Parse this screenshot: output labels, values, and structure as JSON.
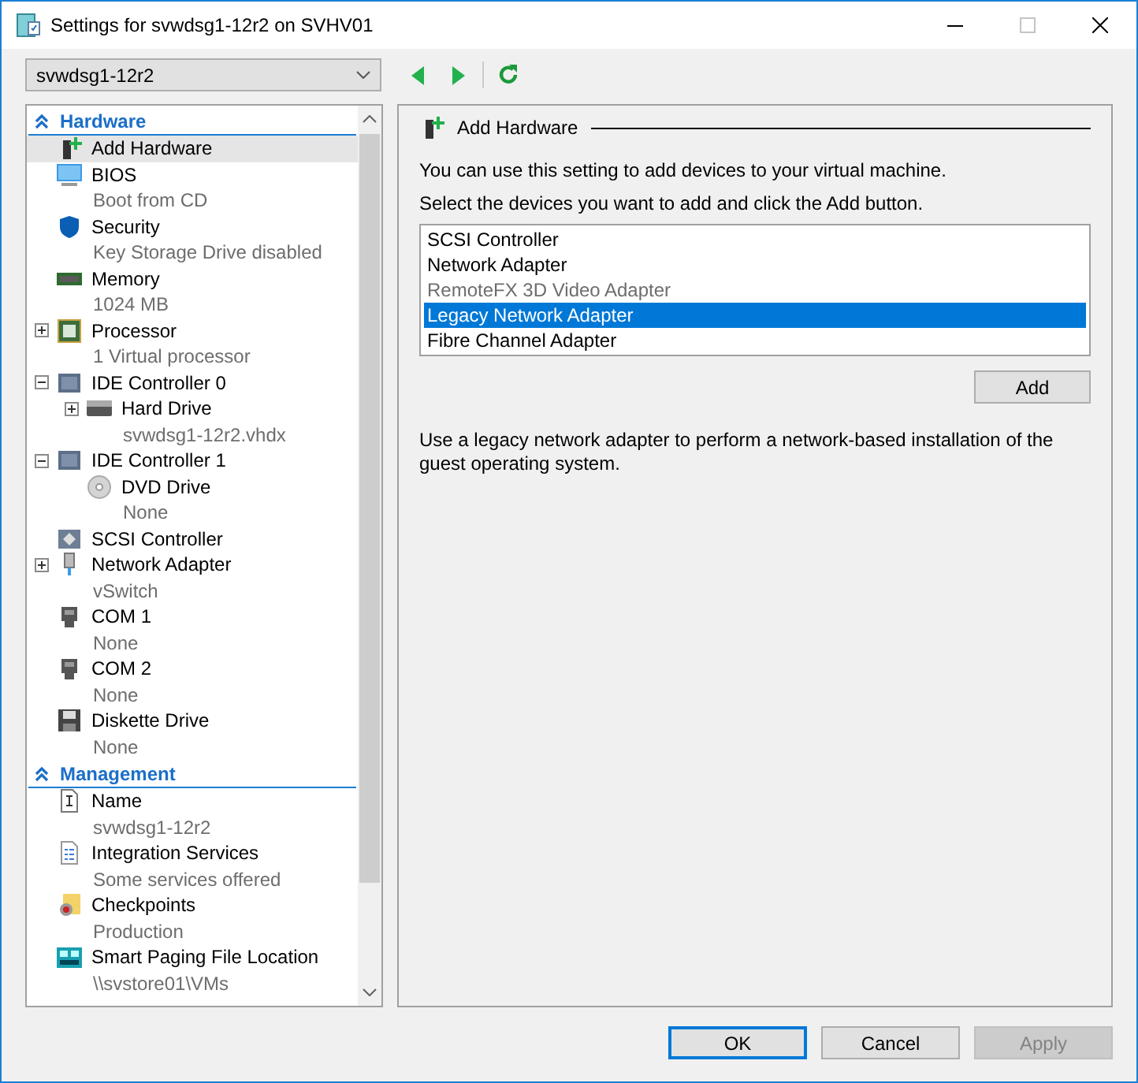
{
  "window": {
    "title": "Settings for svwdsg1-12r2 on SVHV01"
  },
  "vm_selector": {
    "value": "svwdsg1-12r2"
  },
  "sidebar": {
    "sections": [
      {
        "title": "Hardware",
        "expanded": true,
        "items": [
          {
            "kind": "add-hardware",
            "name": "Add Hardware",
            "selected": true
          },
          {
            "kind": "bios",
            "name": "BIOS",
            "detail": "Boot from CD",
            "selected": false
          },
          {
            "kind": "security",
            "name": "Security",
            "detail": "Key Storage Drive disabled",
            "selected": false
          },
          {
            "kind": "memory",
            "name": "Memory",
            "detail": "1024 MB",
            "selected": false
          },
          {
            "kind": "processor",
            "name": "Processor",
            "detail": "1 Virtual processor",
            "expanded": false,
            "selected": false
          },
          {
            "kind": "ide",
            "name": "IDE Controller 0",
            "expanded": true,
            "selected": false,
            "children": [
              {
                "kind": "hard-drive",
                "name": "Hard Drive",
                "detail": "svwdsg1-12r2.vhdx",
                "expanded": false,
                "selected": false
              }
            ]
          },
          {
            "kind": "ide",
            "name": "IDE Controller 1",
            "expanded": true,
            "selected": false,
            "children": [
              {
                "kind": "dvd",
                "name": "DVD Drive",
                "detail": "None",
                "selected": false
              }
            ]
          },
          {
            "kind": "scsi",
            "name": "SCSI Controller",
            "selected": false
          },
          {
            "kind": "network",
            "name": "Network Adapter",
            "detail": "vSwitch",
            "expanded": false,
            "selected": false
          },
          {
            "kind": "com",
            "name": "COM 1",
            "detail": "None",
            "selected": false
          },
          {
            "kind": "com",
            "name": "COM 2",
            "detail": "None",
            "selected": false
          },
          {
            "kind": "diskette",
            "name": "Diskette Drive",
            "detail": "None",
            "selected": false
          }
        ]
      },
      {
        "title": "Management",
        "expanded": true,
        "items": [
          {
            "kind": "name",
            "name": "Name",
            "detail": "svwdsg1-12r2",
            "selected": false
          },
          {
            "kind": "integration",
            "name": "Integration Services",
            "detail": "Some services offered",
            "selected": false
          },
          {
            "kind": "checkpoints",
            "name": "Checkpoints",
            "detail": "Production",
            "selected": false
          },
          {
            "kind": "paging",
            "name": "Smart Paging File Location",
            "detail": "\\\\svstore01\\VMs",
            "selected": false
          }
        ]
      }
    ]
  },
  "panel": {
    "heading": "Add Hardware",
    "intro": "You can use this setting to add devices to your virtual machine.",
    "instruction": "Select the devices you want to add and click the Add button.",
    "devices": [
      {
        "label": "SCSI Controller",
        "selected": false,
        "disabled": false
      },
      {
        "label": "Network Adapter",
        "selected": false,
        "disabled": false
      },
      {
        "label": "RemoteFX 3D Video Adapter",
        "selected": false,
        "disabled": true
      },
      {
        "label": "Legacy Network Adapter",
        "selected": true,
        "disabled": false
      },
      {
        "label": "Fibre Channel Adapter",
        "selected": false,
        "disabled": false
      }
    ],
    "add_button": "Add",
    "description": "Use a legacy network adapter to perform a network-based installation of the guest operating system."
  },
  "buttons": [
    {
      "label": "OK",
      "focused": true,
      "disabled": false
    },
    {
      "label": "Cancel",
      "focused": false,
      "disabled": false
    },
    {
      "label": "Apply",
      "focused": false,
      "disabled": true
    }
  ]
}
